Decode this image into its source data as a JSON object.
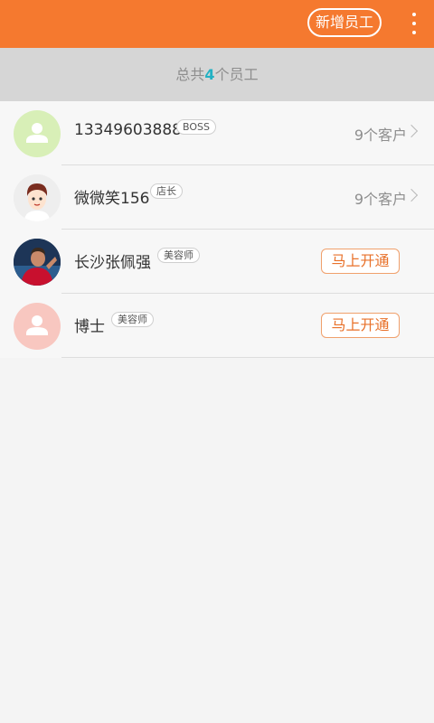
{
  "header": {
    "add_staff_label": "新增员工",
    "more_icon": "more-vertical-icon",
    "bg_color": "#f5792f"
  },
  "summary": {
    "prefix": "总共",
    "count": "4",
    "suffix": "个员工"
  },
  "staff": [
    {
      "name": "13349603888",
      "role": "BOSS",
      "avatar": "default-person-icon",
      "clients": "9个客户"
    },
    {
      "name": "微微笑156",
      "role": "店长",
      "avatar": "cartoon-avatar",
      "clients": "9个客户"
    },
    {
      "name": "长沙张佩强",
      "role": "美容师",
      "avatar": "photo-avatar",
      "action": "马上开通"
    },
    {
      "name": "博士",
      "role": "美容师",
      "avatar": "default-person-icon",
      "action": "马上开通"
    }
  ]
}
